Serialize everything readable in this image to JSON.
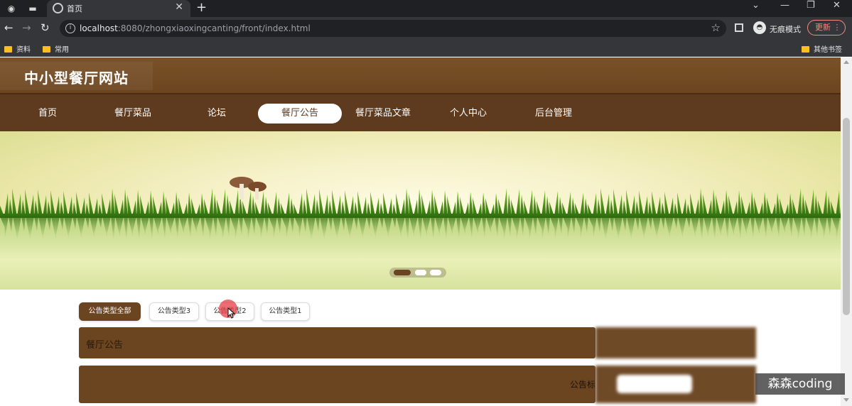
{
  "browser": {
    "tab_title": "首页",
    "url_host": "localhost",
    "url_path": ":8080/zhongxiaoxingcanting/front/index.html",
    "incognito_label": "无痕模式",
    "update_label": "更新",
    "bookmarks": [
      "资料",
      "常用"
    ],
    "other_bookmarks": "其他书签"
  },
  "site": {
    "title": "中小型餐厅网站",
    "nav": [
      {
        "label": "首页"
      },
      {
        "label": "餐厅菜品"
      },
      {
        "label": "论坛"
      },
      {
        "label": "餐厅公告",
        "active": true
      },
      {
        "label": "餐厅菜品文章"
      },
      {
        "label": "个人中心"
      },
      {
        "label": "后台管理"
      }
    ]
  },
  "banner": {
    "slide_count": 3,
    "active_slide": 1
  },
  "categories": [
    {
      "label": "公告类型全部",
      "active": true
    },
    {
      "label": "公告类型3"
    },
    {
      "label": "公告类型2"
    },
    {
      "label": "公告类型1"
    }
  ],
  "notice_section": {
    "title": "餐厅公告"
  },
  "search": {
    "label": "公告标"
  },
  "watermark": "森森coding",
  "colors": {
    "brand_brown": "#6b4420",
    "nav_brown": "#5e3a1e",
    "accent_red": "#e63c46"
  }
}
